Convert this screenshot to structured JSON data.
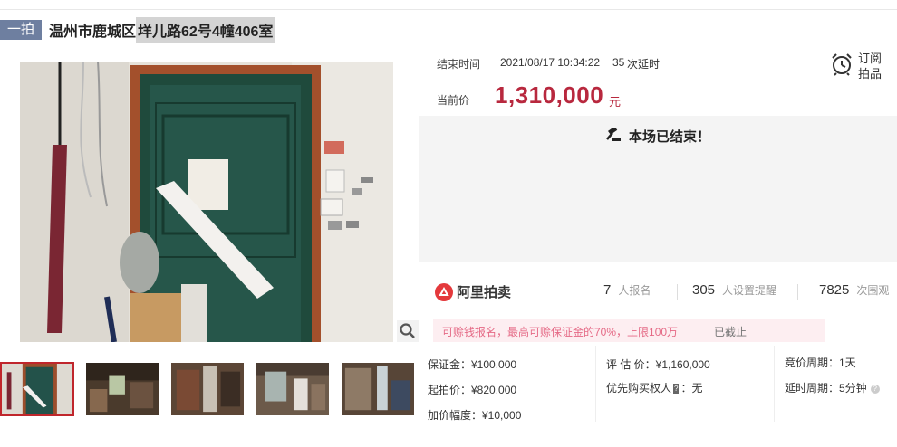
{
  "title": {
    "tag": "一拍",
    "part1": "温州市鹿城区",
    "part2": "垟儿路62号4幢406室"
  },
  "auction": {
    "end_label": "结束时间",
    "end_time": "2021/08/17 10:34:22",
    "delay_count": "35",
    "delay_label": "次延时",
    "current_label": "当前价",
    "current_price": "1,310,000",
    "price_unit": "元",
    "subscribe_line1": "订阅",
    "subscribe_line2": "拍品",
    "ended_message": "本场已结束！"
  },
  "stats": {
    "logo_text": "阿里拍卖",
    "signups": "7",
    "signups_label": "人报名",
    "reminders": "305",
    "reminders_label": "人设置提醒",
    "views": "7825",
    "views_label": "次围观"
  },
  "notice": {
    "text": "可赊钱报名，最高可赊保证金的70%，上限100万",
    "status": "已截止"
  },
  "details": {
    "deposit": "保证金：¥100,000",
    "start_price": "起拍价：¥820,000",
    "increment": "加价幅度：¥10,000",
    "appraisal": "评 估 价：¥1,160,000",
    "priority_label": "优先购买权人",
    "priority_badge": "?",
    "priority_value": "：无",
    "cycle": "竞价周期：1天",
    "delay_cycle": "延时周期：5分钟"
  },
  "colors": {
    "price": "#b8283e",
    "tag_bg": "#6e7fa0",
    "notice_bg": "#fdeef1",
    "thumb_active": "#c0262c"
  },
  "icons": [
    "alarm-clock-icon",
    "gavel-icon",
    "zoom-icon",
    "alibaba-logo-icon",
    "help-icon"
  ]
}
